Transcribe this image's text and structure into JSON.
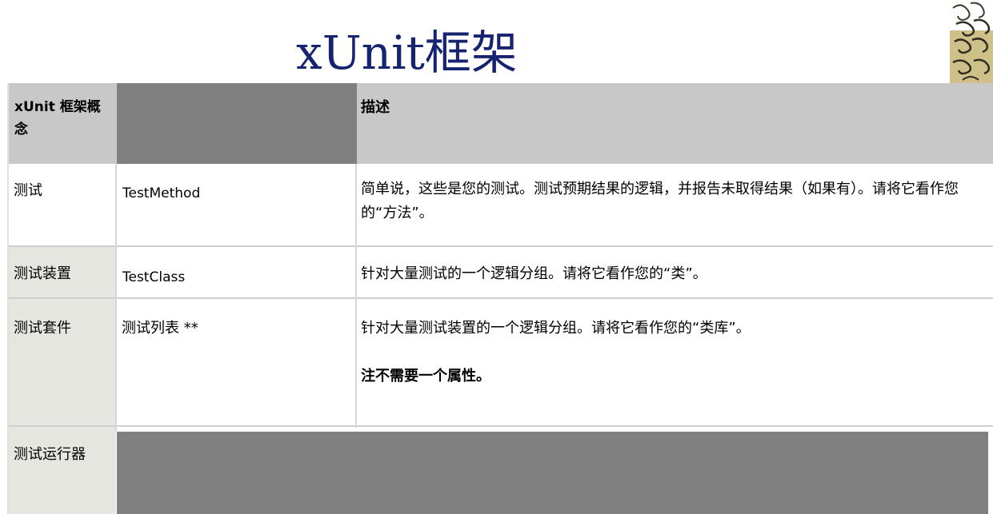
{
  "slide": {
    "title": "xUnit框架",
    "ornament_icon": "floral-ornament-icon"
  },
  "table": {
    "header": {
      "concept": "xUnit 框架概念",
      "description": "描述"
    },
    "rows": [
      {
        "concept": "测试",
        "name": "TestMethod",
        "description": "简单说，这些是您的测试。测试预期结果的逻辑，并报告未取得结果（如果有）。请将它看作您的“方法”。",
        "note": ""
      },
      {
        "concept": "测试装置",
        "name": "TestClass",
        "description": "针对大量测试的一个逻辑分组。请将它看作您的“类”。",
        "note": ""
      },
      {
        "concept": "测试套件",
        "name": "测试列表 **",
        "description": "针对大量测试装置的一个逻辑分组。请将它看作您的“类库”。",
        "note": "注不需要一个属性。"
      },
      {
        "concept": "测试运行器",
        "name": "",
        "description": "",
        "note": ""
      }
    ]
  },
  "colors": {
    "title": "#16236e",
    "header_bg": "#c8c8c8",
    "header_redacted": "#808080",
    "label_column_bg": "#e6e6e0",
    "redacted_block": "#808080"
  }
}
